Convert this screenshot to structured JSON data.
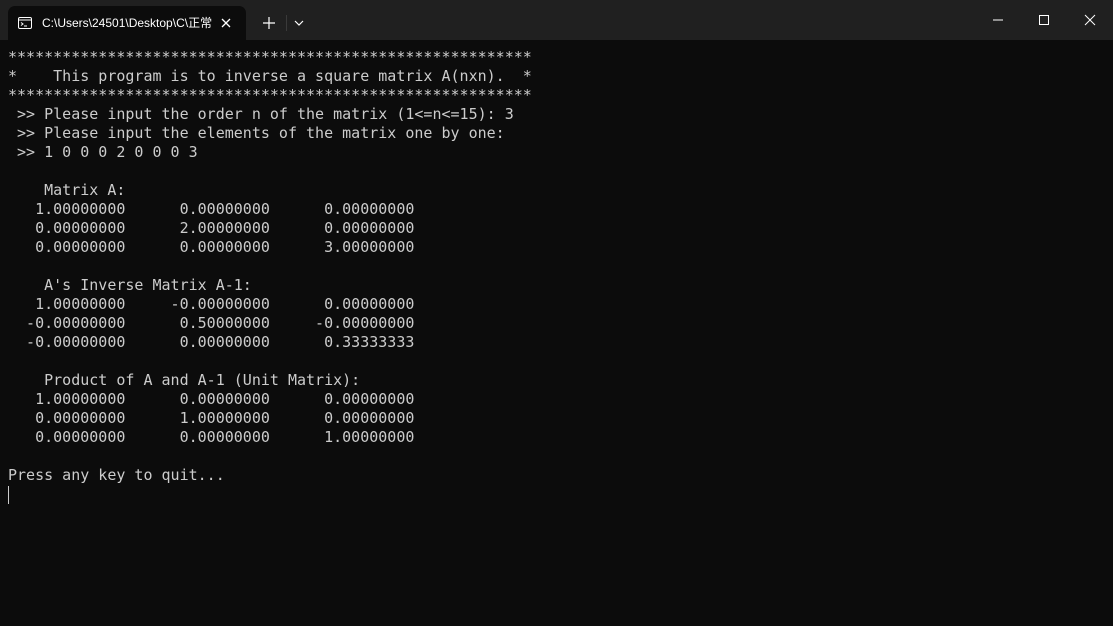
{
  "tab": {
    "title": "C:\\Users\\24501\\Desktop\\C\\正常",
    "icon": "terminal-icon"
  },
  "terminal": {
    "lines": [
      "**********************************************************",
      "*    This program is to inverse a square matrix A(nxn).  *",
      "**********************************************************",
      " >> Please input the order n of the matrix (1<=n<=15): 3",
      " >> Please input the elements of the matrix one by one:",
      " >> 1 0 0 0 2 0 0 0 3",
      "",
      "    Matrix A:",
      "   1.00000000      0.00000000      0.00000000",
      "   0.00000000      2.00000000      0.00000000",
      "   0.00000000      0.00000000      3.00000000",
      "",
      "    A's Inverse Matrix A-1:",
      "   1.00000000     -0.00000000      0.00000000",
      "  -0.00000000      0.50000000     -0.00000000",
      "  -0.00000000      0.00000000      0.33333333",
      "",
      "    Product of A and A-1 (Unit Matrix):",
      "   1.00000000      0.00000000      0.00000000",
      "   0.00000000      1.00000000      0.00000000",
      "   0.00000000      0.00000000      1.00000000",
      "",
      "Press any key to quit..."
    ]
  },
  "colors": {
    "background": "#0c0c0c",
    "titlebar": "#202020",
    "text": "#cccccc"
  }
}
